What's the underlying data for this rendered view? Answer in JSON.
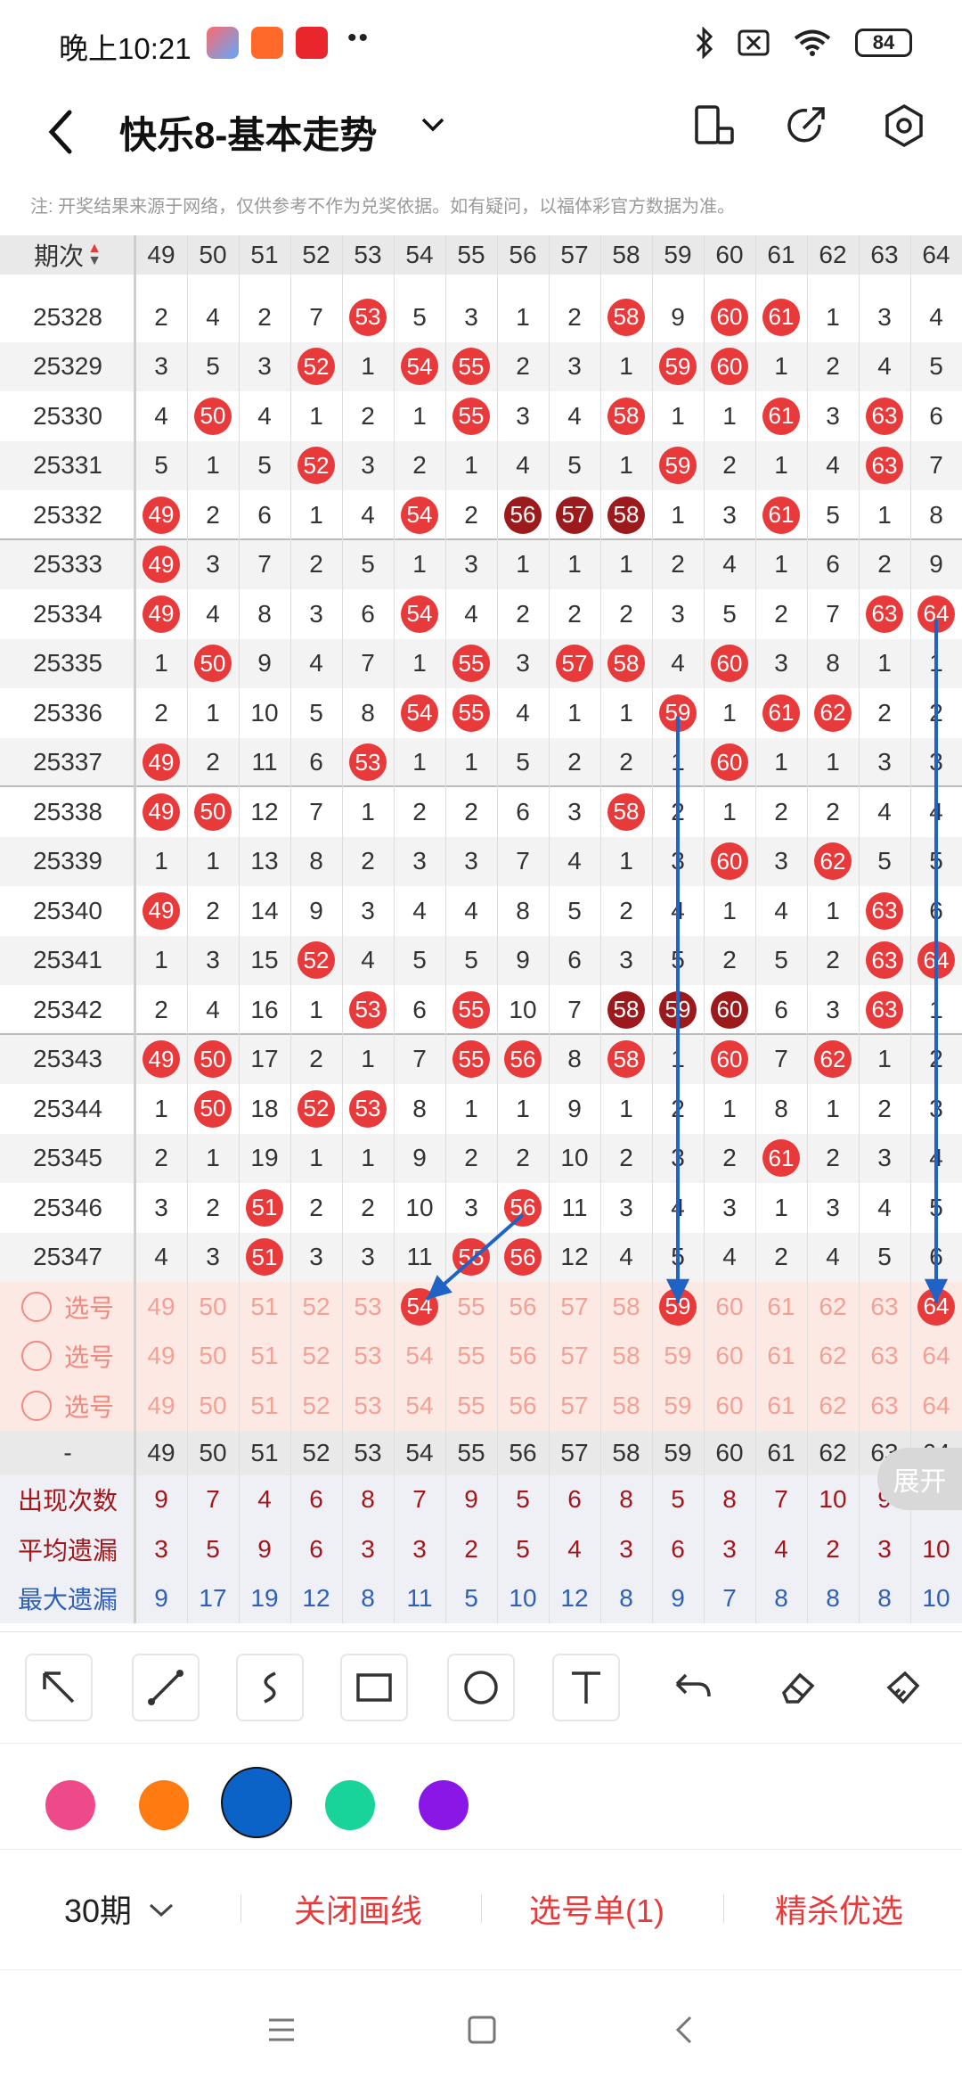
{
  "status_bar": {
    "time": "晚上10:21",
    "dots": "••",
    "battery": "84"
  },
  "header": {
    "title": "快乐8-基本走势"
  },
  "notice": "注: 开奖结果来源于网络，仅供参考不作为兑奖依据。如有疑问，以福体彩官方数据为准。",
  "table": {
    "period_header": "期次",
    "columns": [
      "49",
      "50",
      "51",
      "52",
      "53",
      "54",
      "55",
      "56",
      "57",
      "58",
      "59",
      "60",
      "61",
      "62",
      "63",
      "64"
    ],
    "rows": [
      {
        "period": "25328",
        "cells": [
          "2",
          "4",
          "2",
          "7",
          "53",
          "5",
          "3",
          "1",
          "2",
          "58",
          "9",
          "60",
          "61",
          "1",
          "3",
          "4"
        ]
      },
      {
        "period": "25329",
        "cells": [
          "3",
          "5",
          "3",
          "52",
          "1",
          "54",
          "55",
          "2",
          "3",
          "1",
          "59",
          "60",
          "1",
          "2",
          "4",
          "5"
        ]
      },
      {
        "period": "25330",
        "cells": [
          "4",
          "50",
          "4",
          "1",
          "2",
          "1",
          "55",
          "3",
          "4",
          "58",
          "1",
          "1",
          "61",
          "3",
          "63",
          "6"
        ]
      },
      {
        "period": "25331",
        "cells": [
          "5",
          "1",
          "5",
          "52",
          "3",
          "2",
          "1",
          "4",
          "5",
          "1",
          "59",
          "2",
          "1",
          "4",
          "63",
          "7"
        ]
      },
      {
        "period": "25332",
        "cells": [
          "49",
          "2",
          "6",
          "1",
          "4",
          "54",
          "2",
          "56",
          "57",
          "58",
          "1",
          "3",
          "61",
          "5",
          "1",
          "8"
        ]
      },
      {
        "period": "25333",
        "cells": [
          "49",
          "3",
          "7",
          "2",
          "5",
          "1",
          "3",
          "1",
          "1",
          "1",
          "2",
          "4",
          "1",
          "6",
          "2",
          "9"
        ]
      },
      {
        "period": "25334",
        "cells": [
          "49",
          "4",
          "8",
          "3",
          "6",
          "54",
          "4",
          "2",
          "2",
          "2",
          "3",
          "5",
          "2",
          "7",
          "63",
          "64"
        ]
      },
      {
        "period": "25335",
        "cells": [
          "1",
          "50",
          "9",
          "4",
          "7",
          "1",
          "55",
          "3",
          "57",
          "58",
          "4",
          "60",
          "3",
          "8",
          "1",
          "1"
        ]
      },
      {
        "period": "25336",
        "cells": [
          "2",
          "1",
          "10",
          "5",
          "8",
          "54",
          "55",
          "4",
          "1",
          "1",
          "59",
          "1",
          "61",
          "62",
          "2",
          "2"
        ]
      },
      {
        "period": "25337",
        "cells": [
          "49",
          "2",
          "11",
          "6",
          "53",
          "1",
          "1",
          "5",
          "2",
          "2",
          "1",
          "60",
          "1",
          "1",
          "3",
          "3"
        ]
      },
      {
        "period": "25338",
        "cells": [
          "49",
          "50",
          "12",
          "7",
          "1",
          "2",
          "2",
          "6",
          "3",
          "58",
          "2",
          "1",
          "2",
          "2",
          "4",
          "4"
        ]
      },
      {
        "period": "25339",
        "cells": [
          "1",
          "1",
          "13",
          "8",
          "2",
          "3",
          "3",
          "7",
          "4",
          "1",
          "3",
          "60",
          "3",
          "62",
          "5",
          "5"
        ]
      },
      {
        "period": "25340",
        "cells": [
          "49",
          "2",
          "14",
          "9",
          "3",
          "4",
          "4",
          "8",
          "5",
          "2",
          "4",
          "1",
          "4",
          "1",
          "63",
          "6"
        ]
      },
      {
        "period": "25341",
        "cells": [
          "1",
          "3",
          "15",
          "52",
          "4",
          "5",
          "5",
          "9",
          "6",
          "3",
          "5",
          "2",
          "5",
          "2",
          "63",
          "64"
        ]
      },
      {
        "period": "25342",
        "cells": [
          "2",
          "4",
          "16",
          "1",
          "53",
          "6",
          "55",
          "10",
          "7",
          "58",
          "59",
          "60",
          "6",
          "3",
          "63",
          "1"
        ]
      },
      {
        "period": "25343",
        "cells": [
          "49",
          "50",
          "17",
          "2",
          "1",
          "7",
          "55",
          "56",
          "8",
          "58",
          "1",
          "60",
          "7",
          "62",
          "1",
          "2"
        ]
      },
      {
        "period": "25344",
        "cells": [
          "1",
          "50",
          "18",
          "52",
          "53",
          "8",
          "1",
          "1",
          "9",
          "1",
          "2",
          "1",
          "8",
          "1",
          "2",
          "3"
        ]
      },
      {
        "period": "25345",
        "cells": [
          "2",
          "1",
          "19",
          "1",
          "1",
          "9",
          "2",
          "2",
          "10",
          "2",
          "3",
          "2",
          "61",
          "2",
          "3",
          "4"
        ]
      },
      {
        "period": "25346",
        "cells": [
          "3",
          "2",
          "51",
          "2",
          "2",
          "10",
          "3",
          "56",
          "11",
          "3",
          "4",
          "3",
          "1",
          "3",
          "4",
          "5"
        ]
      },
      {
        "period": "25347",
        "cells": [
          "4",
          "3",
          "51",
          "3",
          "3",
          "11",
          "55",
          "56",
          "12",
          "4",
          "5",
          "4",
          "2",
          "4",
          "5",
          "6"
        ]
      }
    ],
    "select_label": "选号",
    "footer_dash": "-",
    "stats": [
      {
        "label": "出现次数",
        "values": [
          "9",
          "7",
          "4",
          "6",
          "8",
          "7",
          "9",
          "5",
          "6",
          "8",
          "5",
          "8",
          "7",
          "10",
          "9",
          "4"
        ]
      },
      {
        "label": "平均遗漏",
        "values": [
          "3",
          "5",
          "9",
          "6",
          "3",
          "3",
          "2",
          "5",
          "4",
          "3",
          "6",
          "3",
          "4",
          "2",
          "3",
          "10"
        ]
      },
      {
        "label": "最大遗漏",
        "values": [
          "9",
          "17",
          "19",
          "12",
          "8",
          "11",
          "5",
          "10",
          "12",
          "8",
          "9",
          "7",
          "8",
          "8",
          "8",
          "10"
        ]
      }
    ]
  },
  "expand_label": "展开",
  "bottom": {
    "periods": "30期",
    "close_draw": "关闭画线",
    "select_list": "选号单(1)",
    "best_pick": "精杀优选"
  },
  "colors": {
    "accent": "#e8393b",
    "dark_ball": "#9c1a1c",
    "arrow": "#1f63c6"
  },
  "palette": [
    "#ee4a8a",
    "#ff7a10",
    "#0b63c8",
    "#18d39a",
    "#8a17e6"
  ]
}
